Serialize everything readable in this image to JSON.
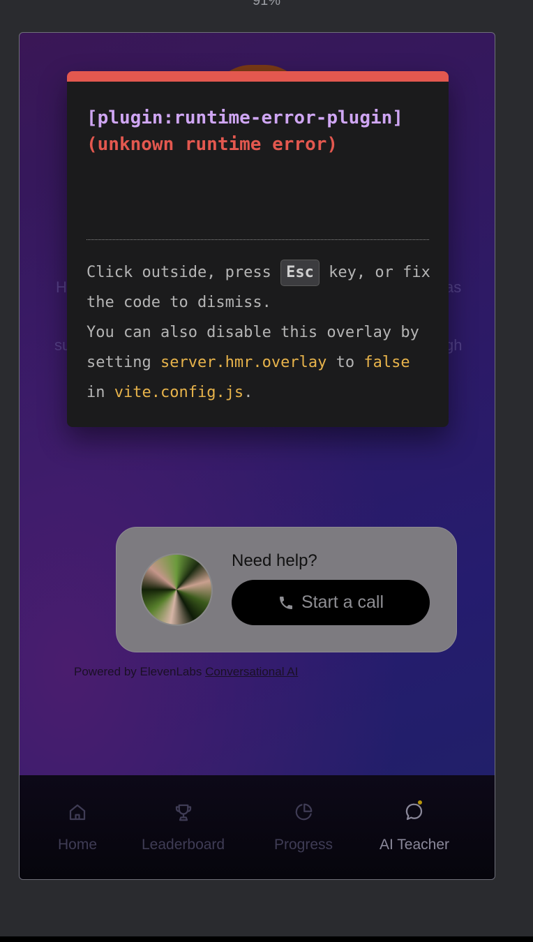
{
  "zoom": "91%",
  "background_text": {
    "left_1": "H",
    "right_1": "as",
    "left_2": "su",
    "right_2": "gh"
  },
  "widget": {
    "need_help": "Need help?",
    "start_call": "Start a call"
  },
  "footer": {
    "powered_prefix": "Powered by ElevenLabs",
    "powered_link": "Conversational AI"
  },
  "tabs": [
    {
      "label": "Home",
      "icon": "home-icon",
      "active": false
    },
    {
      "label": "Leaderboard",
      "icon": "trophy-icon",
      "active": false
    },
    {
      "label": "Progress",
      "icon": "pie-chart-icon",
      "active": false
    },
    {
      "label": "AI Teacher",
      "icon": "chat-bubble-icon",
      "active": true
    }
  ],
  "error_overlay": {
    "title_plugin": "[plugin:runtime-error-plugin]",
    "title_message": "(unknown runtime error)",
    "tip_part1": "Click outside, press",
    "tip_key": "Esc",
    "tip_part2": "key, or fix the code to dismiss.",
    "tip_line2": "You can also disable this overlay by setting",
    "tip_config_key": "server.hmr.overlay",
    "tip_to": "to",
    "tip_false": "false",
    "tip_in": "in",
    "tip_file": "vite.config.js",
    "tip_end": "."
  },
  "colors": {
    "overlay_accent": "#e3584f",
    "plugin_text": "#cfa6f3",
    "code_highlight": "#e7b34b",
    "active_dot": "#b8960a"
  }
}
